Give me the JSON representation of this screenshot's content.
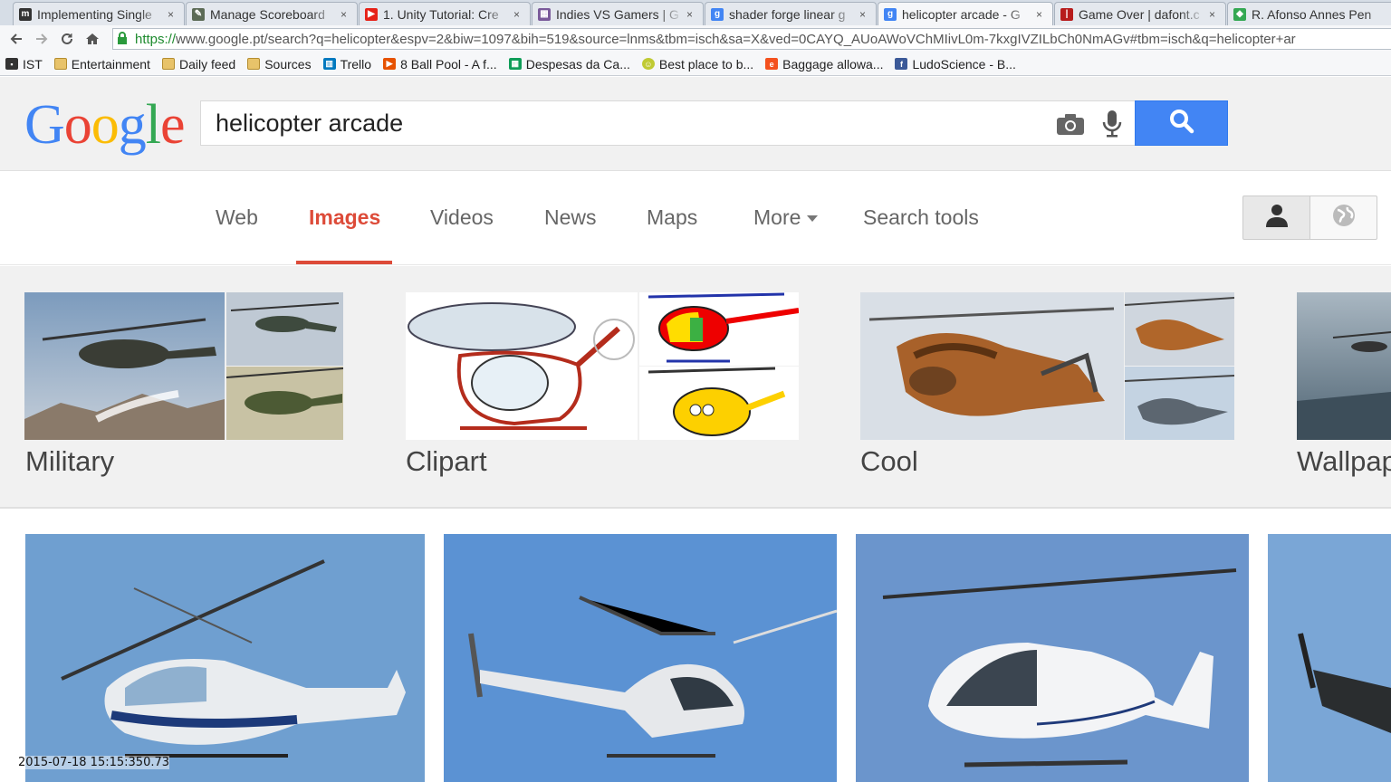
{
  "browser": {
    "tabs": [
      {
        "title": "Implementing Single",
        "icon": "m-favicon",
        "color": "#333333"
      },
      {
        "title": "Manage Scoreboard",
        "icon": "scoreboard-favicon",
        "color": "#555555"
      },
      {
        "title": "1. Unity Tutorial: Cre",
        "icon": "youtube-favicon",
        "color": "#e62117"
      },
      {
        "title": "Indies VS Gamers | G",
        "icon": "indies-favicon",
        "color": "#7a5a9a"
      },
      {
        "title": "shader forge linear g",
        "icon": "google-favicon",
        "color": "#4285f4"
      },
      {
        "title": "helicopter arcade - G",
        "icon": "google-favicon",
        "color": "#4285f4"
      },
      {
        "title": "Game Over | dafont.c",
        "icon": "dafont-favicon",
        "color": "#b71c1c"
      },
      {
        "title": "R. Afonso Annes Pen",
        "icon": "maps-favicon",
        "color": "#34a853"
      }
    ],
    "close_glyph": "×",
    "url_https": "https://",
    "url_rest": "www.google.pt/search?q=helicopter&espv=2&biw=1097&bih=519&source=lnms&tbm=isch&sa=X&ved=0CAYQ_AUoAWoVChMIivL0m-7kxgIVZILbCh0NmAGv#tbm=isch&q=helicopter+ar"
  },
  "bookmarks": [
    {
      "label": "IST",
      "type": "folder"
    },
    {
      "label": "Entertainment",
      "type": "folder"
    },
    {
      "label": "Daily feed",
      "type": "folder"
    },
    {
      "label": "Sources",
      "type": "folder"
    },
    {
      "label": "Trello",
      "type": "site",
      "color": "#0079bf"
    },
    {
      "label": "8 Ball Pool - A f...",
      "type": "site",
      "color": "#e65100"
    },
    {
      "label": "Despesas da Ca...",
      "type": "site",
      "color": "#0f9d58"
    },
    {
      "label": "Best place to b...",
      "type": "site",
      "color": "#c0ca33"
    },
    {
      "label": "Baggage allowa...",
      "type": "site",
      "color": "#f4511e"
    },
    {
      "label": "LudoScience - B...",
      "type": "site",
      "color": "#3b5998"
    }
  ],
  "google": {
    "logo_letters": [
      {
        "ch": "G",
        "color": "#4285f4"
      },
      {
        "ch": "o",
        "color": "#ea4335"
      },
      {
        "ch": "o",
        "color": "#fbbc05"
      },
      {
        "ch": "g",
        "color": "#4285f4"
      },
      {
        "ch": "l",
        "color": "#34a853"
      },
      {
        "ch": "e",
        "color": "#ea4335"
      }
    ],
    "query": "helicopter arcade"
  },
  "nav": {
    "web": "Web",
    "images": "Images",
    "videos": "Videos",
    "news": "News",
    "maps": "Maps",
    "more": "More",
    "search_tools": "Search tools"
  },
  "categories": [
    {
      "label": "Military"
    },
    {
      "label": "Clipart"
    },
    {
      "label": "Cool"
    },
    {
      "label": "Wallpap"
    }
  ],
  "timestamp": "2015-07-18 15:15:350.73"
}
